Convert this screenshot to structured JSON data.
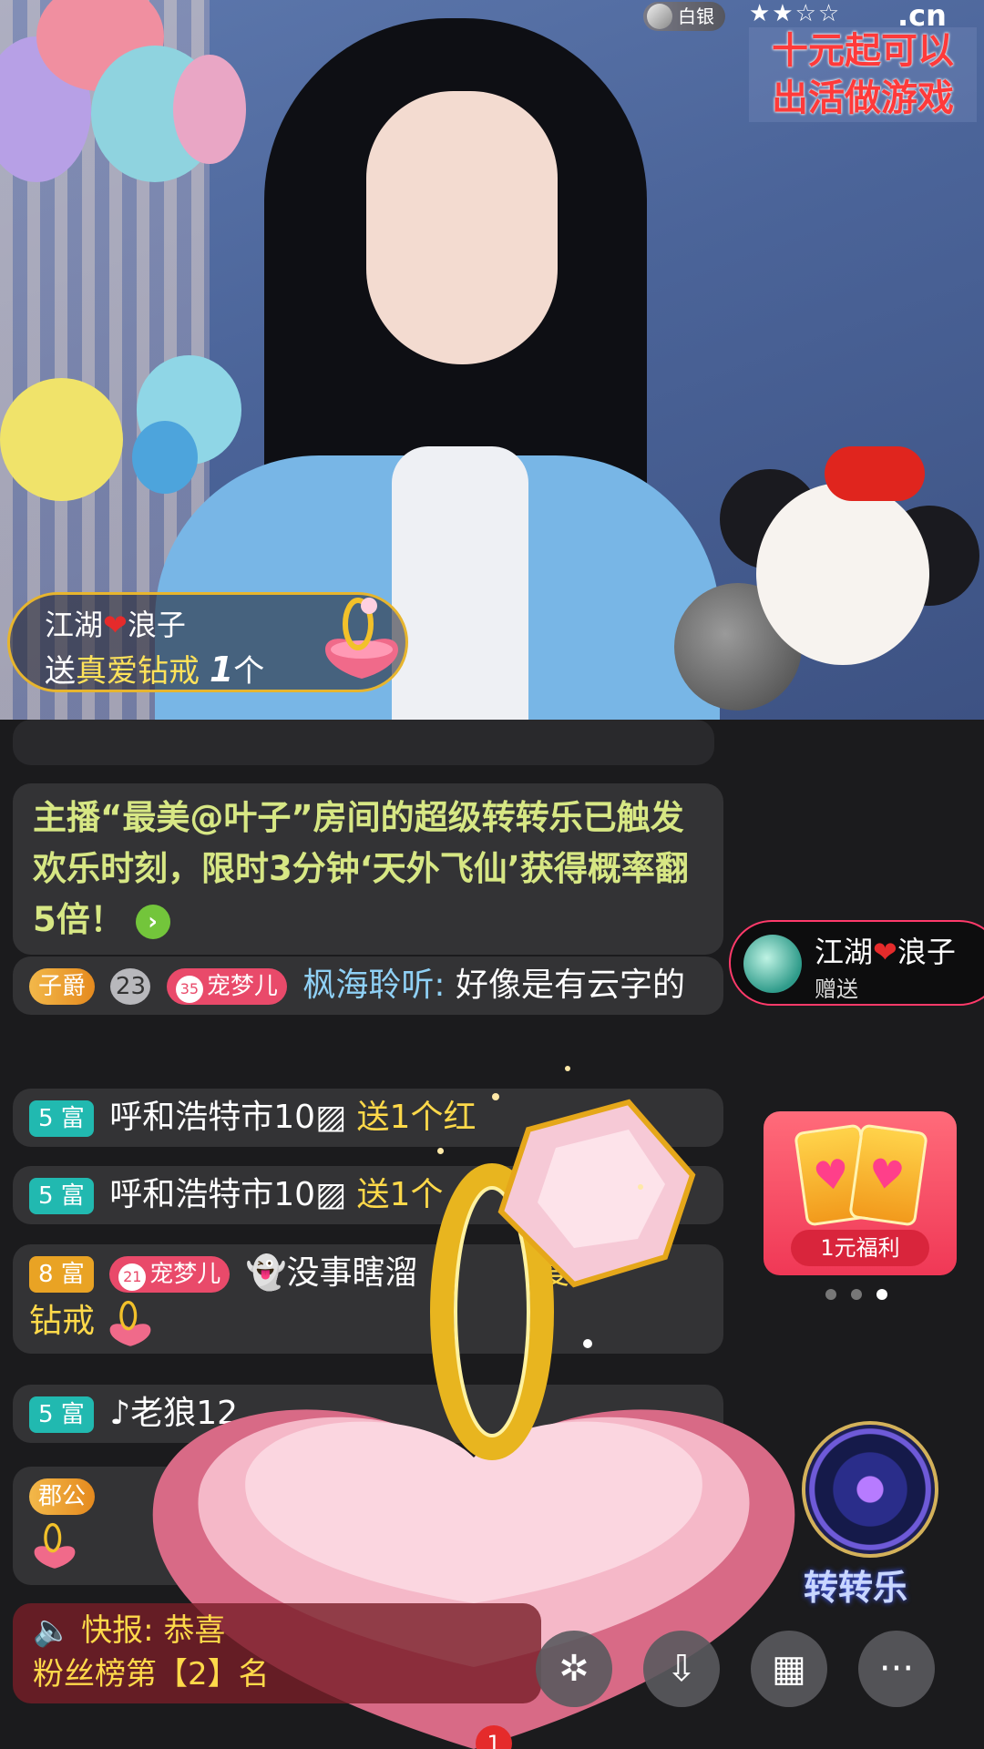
{
  "stream": {
    "rank_label": "白银",
    "star_rating": "★★☆☆",
    "site_logo": ".cn",
    "promo_line1": "十元起可以",
    "promo_line2": "出活做游戏"
  },
  "gift_banner": {
    "user": "江湖",
    "user_suffix": "浪子",
    "send_prefix": "送",
    "gift_name": "真爱钻戒",
    "count": "1",
    "unit": "个"
  },
  "chat": {
    "system_message": "主播“最美@叶子”房间的超级转转乐已触发欢乐时刻，限时3分钟‘天外飞仙’获得概率翻5倍！",
    "messages": [
      {
        "noble": "子爵",
        "guard_level": "23",
        "pet_level": "35",
        "pet_name": "宠梦儿",
        "user": "枫海聆听:",
        "text": "好像是有云字的"
      },
      {
        "rich": "5 富",
        "user": "呼和浩特市10▨",
        "action": "送1个红"
      },
      {
        "rich": "5 富",
        "user": "呼和浩特市10▨",
        "action": "送1个"
      },
      {
        "rich": "8 富",
        "pet_level": "21",
        "pet_name": "宠梦儿",
        "user": "👻没事瞎溜",
        "action_tail": "爱",
        "gift": "钻戒"
      },
      {
        "rich": "5 富",
        "user": "♪老狼12"
      },
      {
        "noble": "郡公"
      }
    ],
    "flash_label": "快报:",
    "flash_text1": "恭喜",
    "flash_text2": "粉丝榜第【2】名"
  },
  "side": {
    "sender_name": "江湖",
    "sender_suffix": "浪子",
    "sender_action": "赠送",
    "welfare_label": "1元福利",
    "wheel_label": "转转乐"
  },
  "toolbar": {
    "notif_count": "1"
  },
  "colors": {
    "accent_gold": "#ffd94a",
    "system_text": "#d7e784",
    "username": "#8fd0f5",
    "heart": "#e52b2b"
  }
}
